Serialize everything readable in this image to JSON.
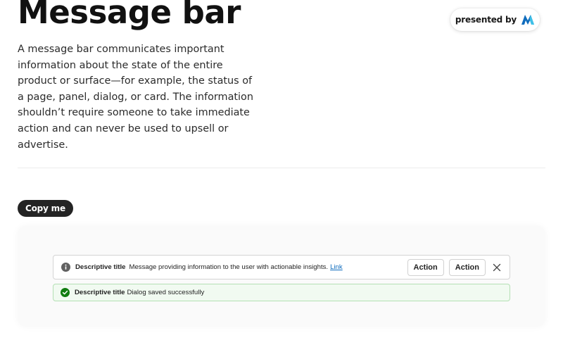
{
  "header": {
    "title": "Message bar",
    "presented_by_label": "presented by",
    "logo_icon": "brand-logo-icon"
  },
  "intro": {
    "text": "A message bar communicates important information about the state of the entire product or surface—for example, the status of a page, panel, dialog, or card. The information shouldn’t require someone to take immediate action and can never be used to upsell or advertise."
  },
  "copy_button": {
    "label": "Copy me"
  },
  "preview": {
    "info_bar": {
      "icon": "info-icon",
      "title": "Descriptive title",
      "message": "Message providing information to the user with actionable insights.",
      "link": "Link",
      "actions": [
        "Action",
        "Action"
      ],
      "dismiss_icon": "close-icon"
    },
    "success_bar": {
      "icon": "checkmark-circle-icon",
      "title": "Descriptive title",
      "message": "Dialog saved successfully"
    }
  },
  "colors": {
    "text": "#242424",
    "copy_button_bg": "#242424",
    "info_icon": "#616161",
    "success_icon": "#107c10",
    "success_bg": "#f1faf1",
    "success_border": "#b4e0b4",
    "link": "#0f6cbd",
    "logo_primary": "#0f6cbd",
    "logo_secondary": "#3ec1e8"
  }
}
